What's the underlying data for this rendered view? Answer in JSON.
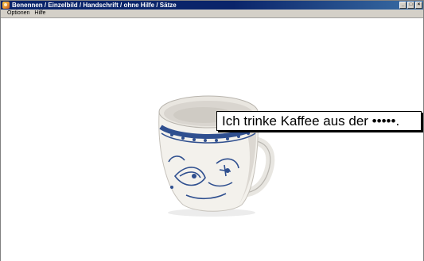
{
  "window": {
    "title": "Benennen / Einzelbild / Handschrift / ohne Hilfe / Sätze",
    "minimize_glyph": "_",
    "maximize_glyph": "□",
    "close_glyph": "×"
  },
  "menu": {
    "items": [
      {
        "label": "Optionen"
      },
      {
        "label": "Hilfe"
      }
    ]
  },
  "exercise": {
    "sentence": "Ich trinke Kaffee aus der •••••.",
    "image_icon": "cup-icon"
  },
  "colors": {
    "titlebar": "#0a246a",
    "menubar": "#d4d0c8",
    "background": "#ffffff",
    "porcelain_pattern": "#2f4f8f"
  }
}
